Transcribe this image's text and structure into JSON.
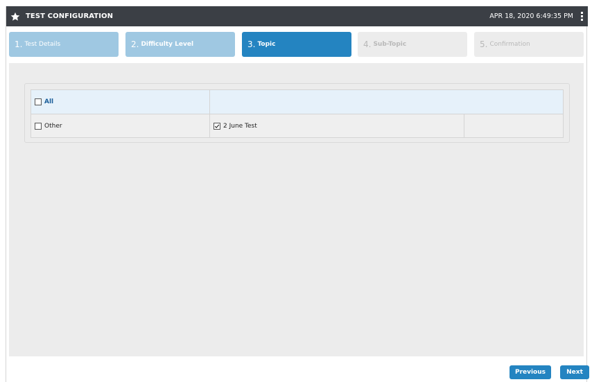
{
  "header": {
    "title": "TEST CONFIGURATION",
    "datetime": "APR 18, 2020  6:49:35 PM",
    "star_icon": "star-icon",
    "menu_icon": "vertical-ellipsis-icon"
  },
  "steps": [
    {
      "num": "1.",
      "label": "Test Details",
      "state": "done"
    },
    {
      "num": "2.",
      "label": "Difficulty Level",
      "state": "done"
    },
    {
      "num": "3.",
      "label": "Topic",
      "state": "active"
    },
    {
      "num": "4.",
      "label": "Sub-Topic",
      "state": "pending"
    },
    {
      "num": "5.",
      "label": "Confirmation",
      "state": "pending"
    }
  ],
  "topics": {
    "all_label": "All",
    "all_checked": false,
    "rows": [
      {
        "label": "Other",
        "checked": false
      },
      {
        "label": "2 June Test",
        "checked": true
      }
    ]
  },
  "buttons": {
    "previous": "Previous",
    "next": "Next"
  },
  "colors": {
    "header_bg": "#3b3f45",
    "step_done": "#9fc8e2",
    "step_active": "#2484c1",
    "step_pending": "#ececec",
    "button": "#2484c1"
  }
}
